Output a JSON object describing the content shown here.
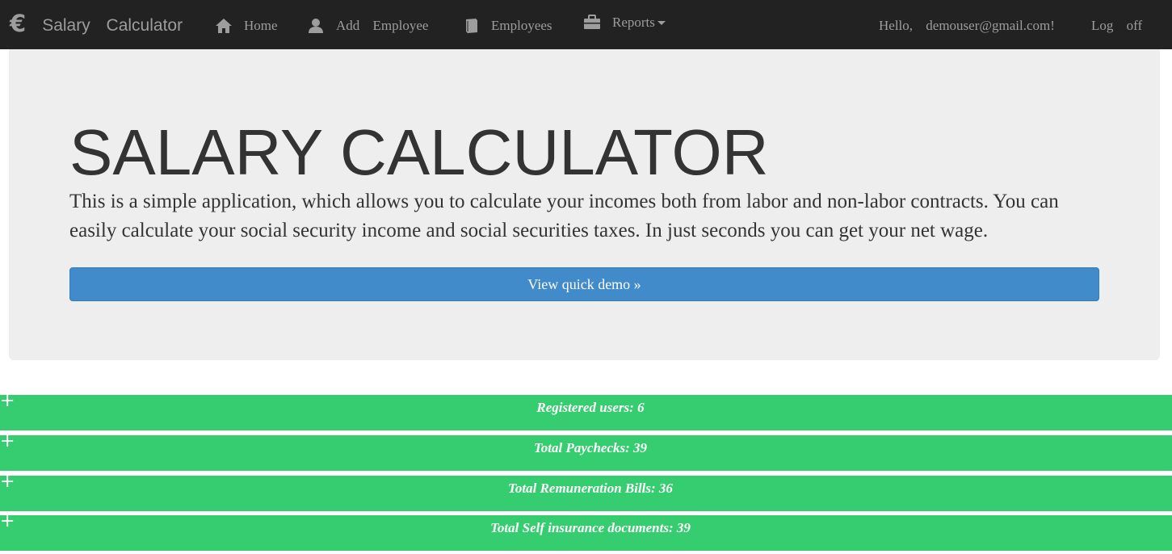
{
  "nav": {
    "brand_icon": "euro-icon",
    "brand_text": "Salary Calculator",
    "items": [
      {
        "label": "Home",
        "icon": "home-icon"
      },
      {
        "label": "Add Employee",
        "icon": "user-icon"
      },
      {
        "label": "Employees",
        "icon": "book-icon"
      },
      {
        "label": "Reports",
        "icon": "briefcase-icon"
      }
    ],
    "greeting": "Hello, demouser@gmail.com!",
    "logoff": "Log off"
  },
  "hero": {
    "title": "SALARY CALCULATOR",
    "text": "This is a simple application, which allows you to calculate your incomes both from labor and non-labor contracts. You can easily calculate your social security income and social securities taxes. In just seconds you can get your net wage.",
    "button": "View quick demo »"
  },
  "stats": [
    {
      "toggle": "+",
      "label": "Registered users: 6"
    },
    {
      "toggle": "+",
      "label": "Total Paychecks: 39"
    },
    {
      "toggle": "+",
      "label": "Total Remuneration Bills: 36"
    },
    {
      "toggle": "+",
      "label": "Total Self insurance documents: 39"
    }
  ],
  "colors": {
    "navbar": "#222222",
    "nav_text": "#9d9d9d",
    "jumbotron": "#eeeeee",
    "primary_button": "#428bca",
    "stat_bar": "#36cd71"
  }
}
